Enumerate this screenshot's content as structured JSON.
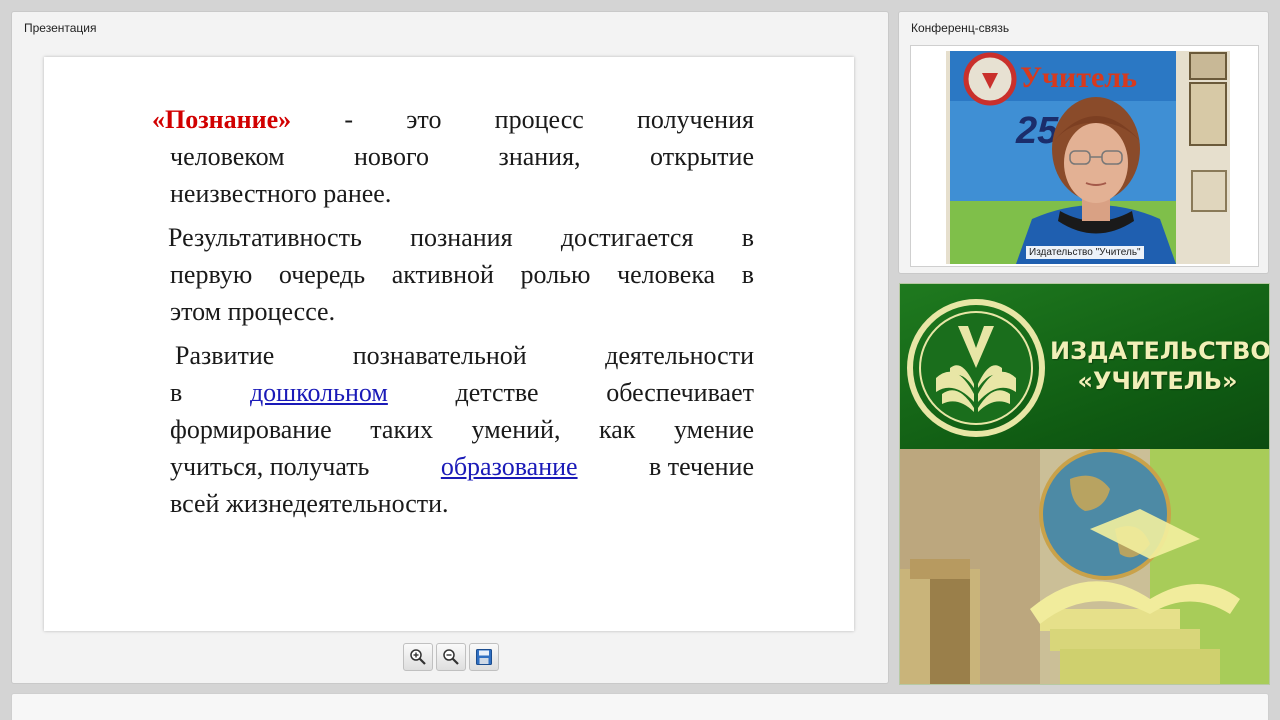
{
  "presentation": {
    "title": "Презентация",
    "para1": {
      "term": "«Познание»",
      "line1_rest": [
        "-",
        "это",
        "процесс",
        "получения"
      ],
      "line2": "человеком нового знания, открытие",
      "line3": "неизвестного ранее."
    },
    "para2": {
      "line1": "Результативность познания достигается в",
      "line2": "первую очередь активной ролью человека в",
      "line3": "этом процессе."
    },
    "para3": {
      "line1": "Развитие познавательной деятельности",
      "line2_pre": "в",
      "line2_link": "дошкольном",
      "line2_post1": "детстве",
      "line2_post2": "обеспечивает",
      "line3": "формирование таких умений, как умение",
      "line4_pre": "учиться, получать",
      "line4_link": "образование",
      "line4_post": "в течение",
      "line5": "всей жизнедеятельности."
    },
    "toolbar": {
      "zoom_in_icon": "zoom-in-icon",
      "zoom_out_icon": "zoom-out-icon",
      "save_icon": "save-icon"
    },
    "colors": {
      "term": "#d10000",
      "link": "#1a1ab8"
    }
  },
  "conference": {
    "title": "Конференц-связь",
    "video_caption": "Издательство \"Учитель\"",
    "poster_text": "Учитель"
  },
  "banner": {
    "line1": "ИЗДАТЕЛЬСТВО",
    "line2": "«УЧИТЕЛЬ»",
    "colors": {
      "green": "#137018",
      "text": "#f2efb8"
    }
  }
}
